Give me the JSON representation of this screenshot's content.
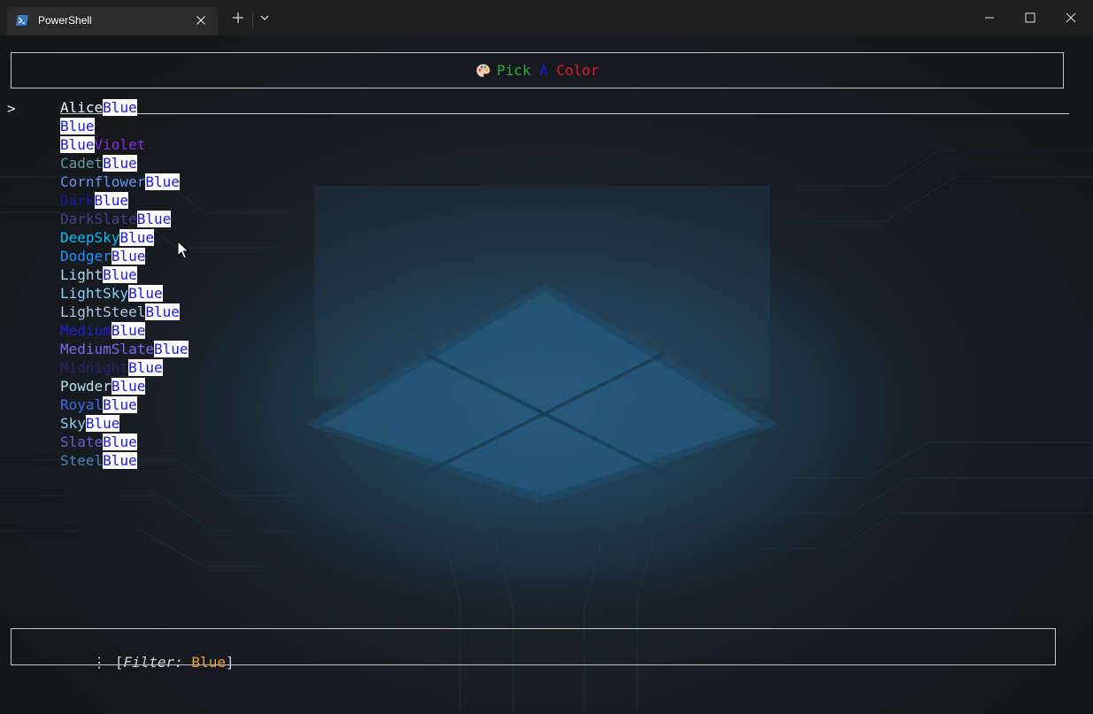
{
  "titlebar": {
    "tab_title": "PowerShell",
    "tab_icon": "powershell-icon",
    "close_icon": "close-icon",
    "new_tab_icon": "plus-icon",
    "dropdown_icon": "chevron-down-icon",
    "minimize_icon": "minimize-icon",
    "maximize_icon": "maximize-icon",
    "window_close_icon": "close-icon"
  },
  "header": {
    "icon": "palette-icon",
    "word1": "Pick",
    "word2": "A",
    "word3": "Color",
    "colors": {
      "word1": "#2faa3a",
      "word2": "#1a1adc",
      "word3": "#dc2020"
    }
  },
  "selector": {
    "pointer": ">"
  },
  "colors_list": [
    {
      "prefix": "Alice",
      "match": "Blue",
      "suffix": "",
      "color": "#f0f8ff"
    },
    {
      "prefix": "",
      "match": "Blue",
      "suffix": "",
      "color": "#4040ff"
    },
    {
      "prefix": "",
      "match": "Blue",
      "suffix": "Violet",
      "color": "#8a2be2"
    },
    {
      "prefix": "Cadet",
      "match": "Blue",
      "suffix": "",
      "color": "#5f9ea0"
    },
    {
      "prefix": "Cornflower",
      "match": "Blue",
      "suffix": "",
      "color": "#6495ed"
    },
    {
      "prefix": "Dark",
      "match": "Blue",
      "suffix": "",
      "color": "#1a1aa0"
    },
    {
      "prefix": "DarkSlate",
      "match": "Blue",
      "suffix": "",
      "color": "#483d8b"
    },
    {
      "prefix": "DeepSky",
      "match": "Blue",
      "suffix": "",
      "color": "#00bfff"
    },
    {
      "prefix": "Dodger",
      "match": "Blue",
      "suffix": "",
      "color": "#1e90ff"
    },
    {
      "prefix": "Light",
      "match": "Blue",
      "suffix": "",
      "color": "#add8e6"
    },
    {
      "prefix": "LightSky",
      "match": "Blue",
      "suffix": "",
      "color": "#87cefa"
    },
    {
      "prefix": "LightSteel",
      "match": "Blue",
      "suffix": "",
      "color": "#b0c4de"
    },
    {
      "prefix": "Medium",
      "match": "Blue",
      "suffix": "",
      "color": "#2020d0"
    },
    {
      "prefix": "MediumSlate",
      "match": "Blue",
      "suffix": "",
      "color": "#7b68ee"
    },
    {
      "prefix": "Midnight",
      "match": "Blue",
      "suffix": "",
      "color": "#25256e"
    },
    {
      "prefix": "Powder",
      "match": "Blue",
      "suffix": "",
      "color": "#b0e0e6"
    },
    {
      "prefix": "Royal",
      "match": "Blue",
      "suffix": "",
      "color": "#4169e1"
    },
    {
      "prefix": "Sky",
      "match": "Blue",
      "suffix": "",
      "color": "#87ceeb"
    },
    {
      "prefix": "Slate",
      "match": "Blue",
      "suffix": "",
      "color": "#6a5acd"
    },
    {
      "prefix": "Steel",
      "match": "Blue",
      "suffix": "",
      "color": "#4682b4"
    }
  ],
  "footer": {
    "dots_icon": "vertical-ellipsis-icon",
    "dots": "⋮",
    "open_bracket": "[",
    "filter_label": "Filter:",
    "filter_value": "Blue",
    "close_bracket": "]"
  }
}
